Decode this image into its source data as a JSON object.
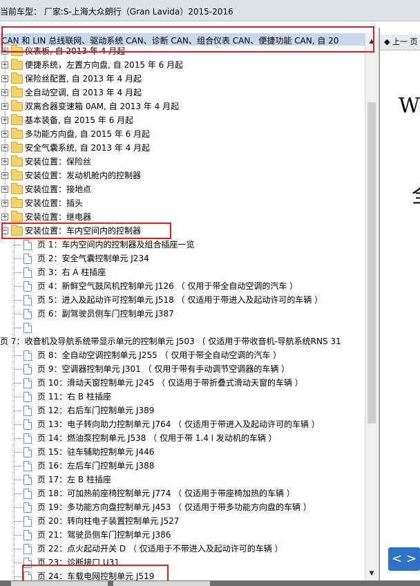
{
  "window": {
    "title": "当前车型： 厂家:S-上海大众朗行（Gran Lavida）2015-2016"
  },
  "tree": {
    "header": "CAN 和 LIN 总线联网、驱动系统 CAN、诊断 CAN、组合仪表 CAN、便捷功能 CAN, 自 20",
    "folders": [
      "仪表板, 自 2013 年 4 月起",
      "便捷系统，左置方向盘, 自 2015 年 6 月起",
      "保险丝配置, 自 2013 年 4 月起",
      "全自动空调, 自 2013 年 4 月起",
      "双离合器变速箱 0AM, 自 2013 年 4 月起",
      "基本装备, 自 2015 年 6 月起",
      "多功能方向盘, 自 2015 年 6 月起",
      "安全气囊系统, 自 2013 年 4 月起",
      "安装位置：保险丝",
      "安装位置：发动机舱内的控制器",
      "安装位置：接地点",
      "安装位置：插头",
      "安装位置：继电器"
    ],
    "open_folder": "安装位置：车内空间内的控制器",
    "pages_a": [
      "页 1：车内空间内的控制器及组合插座一览",
      "页 2：安全气囊控制单元 J234",
      "页 3：右 A 柱插座",
      "页 4：新鲜空气鼓风机控制单元 J126 （ 仅用于带全自动空调的汽车 ）",
      "页 5：进入及起动许可控制单元 J518 （ 仅适用于带进入及起动许可的车辆 ）",
      "页 6：副驾驶员侧车门控制单元 J387",
      ""
    ],
    "page7": "页 7：收音机及导航系统带显示单元的控制单元 J503 （ 仅适用于带收音机-导航系统RNS 31",
    "pages_b": [
      "页 8：全自动空调控制单元 J255 （ 仅用于带全自动空调的汽车 ）",
      "页 9：空调器控制单元 J301 （ 仅用于带有手动调节空调器的车辆 ）",
      "页 10：滑动天窗控制单元 J245 （ 仅适用于带折叠式滑动天窗的车辆 ）",
      "页 11：右 B 柱插座",
      "页 12：右后车门控制单元 J389",
      "页 13：电子转向助力控制单元 J764 （ 仅适用于带进入及起动许可的车辆 ）",
      "页 14：燃油泵控制单元 J538 （ 仅用于带 1.4 l 发动机的车辆 ）",
      "页 15：驻车辅助控制单元 J446",
      "页 16：左后车门控制单元 J388",
      "页 17：左 B 柱插座",
      "页 18：可加热前座椅控制单元 J774 （ 仅适用于带座椅加热的车辆 ）",
      "页 19：多功能方向盘控制单元 J453 （ 仅适用于带多功能方向盘的车辆 ）",
      "页 20：转向柱电子装置控制单元 J527",
      "页 21：驾驶员侧车门控制单元 J386",
      "页 22：点火起动开关 D （ 仅适用于不带进入及起动许可的车辆 ）",
      "页 23：诊断接口 U31",
      "页 24：车载电网控制单元 J519"
    ]
  },
  "viewer": {
    "prev_label": "上一 页",
    "heading_letter": "W",
    "heading_glyph": "全",
    "pager_label": "< >"
  },
  "colors": {
    "highlight": "#e02020",
    "header_bg": "#c9d6ee",
    "pager_bg": "#2f73c9"
  }
}
